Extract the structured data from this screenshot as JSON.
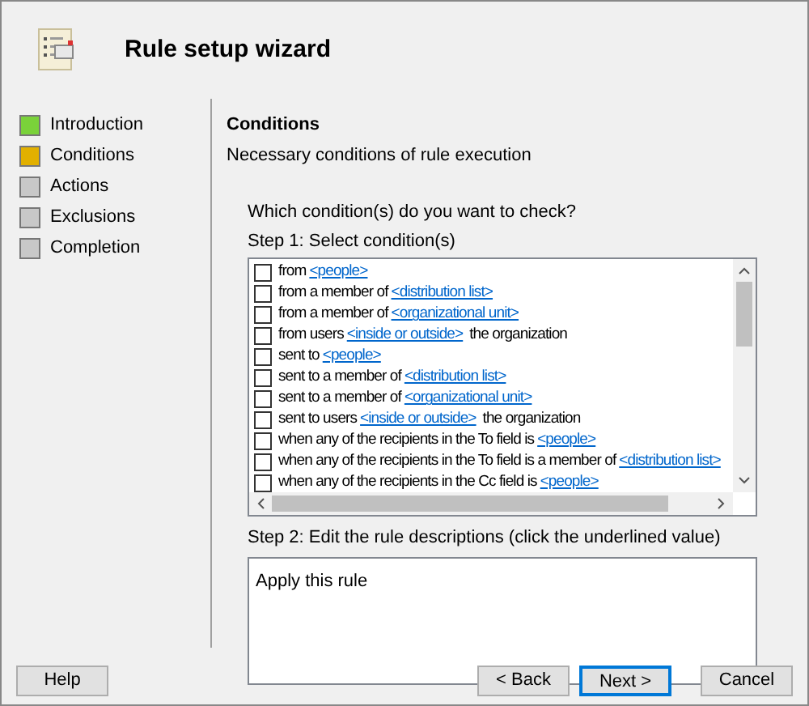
{
  "window": {
    "title": "Rule setup wizard"
  },
  "steps": [
    {
      "label": "Introduction",
      "color": "#7ad23a"
    },
    {
      "label": "Conditions",
      "color": "#e2b000"
    },
    {
      "label": "Actions",
      "color": "#c8c8c8"
    },
    {
      "label": "Exclusions",
      "color": "#c8c8c8"
    },
    {
      "label": "Completion",
      "color": "#c8c8c8"
    }
  ],
  "section": {
    "title": "Conditions",
    "subtitle": "Necessary conditions of rule execution"
  },
  "question": "Which condition(s) do you want to check?",
  "step1_label": "Step 1: Select condition(s)",
  "conditions": [
    {
      "before": "from",
      "link": "<people>",
      "checked": false
    },
    {
      "before": "from a member of",
      "link": "<distribution list>",
      "checked": false
    },
    {
      "before": "from a member of",
      "link": "<organizational unit>",
      "checked": false
    },
    {
      "before": "from users",
      "link": "<inside or outside>",
      "after": "the organization",
      "checked": false
    },
    {
      "before": "sent to",
      "link": "<people>",
      "checked": false
    },
    {
      "before": "sent to a member of",
      "link": "<distribution list>",
      "checked": false
    },
    {
      "before": "sent to a member of",
      "link": "<organizational unit>",
      "checked": false
    },
    {
      "before": "sent to users",
      "link": "<inside or outside>",
      "after": "the organization",
      "checked": false
    },
    {
      "before": "when any of the recipients in the To field is",
      "link": "<people>",
      "checked": false
    },
    {
      "before": "when any of the recipients in the To field is a member of",
      "link": "<distribution list>",
      "checked": false
    },
    {
      "before": "when any of the recipients in the Cc field is",
      "link": "<people>",
      "checked": false
    }
  ],
  "step2_label": "Step 2: Edit the rule descriptions (click the underlined value)",
  "description": "Apply this rule",
  "buttons": [
    {
      "label": "Help",
      "kind": "help",
      "default": false
    },
    {
      "label": "< Back",
      "kind": "nav",
      "default": false
    },
    {
      "label": "Next >",
      "kind": "nav",
      "default": true
    },
    {
      "label": "Cancel",
      "kind": "cancel",
      "default": false
    }
  ]
}
